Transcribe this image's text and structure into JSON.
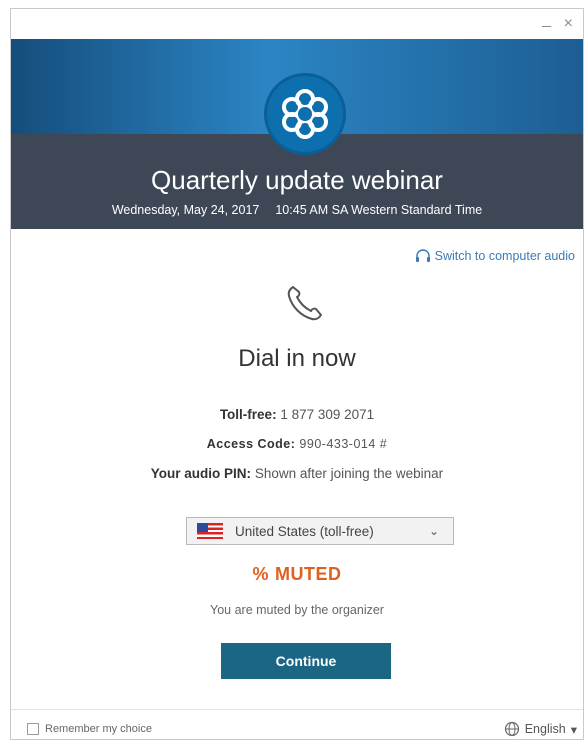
{
  "window": {
    "minimize_label": "_",
    "close_label": "×"
  },
  "banner": {
    "title": "Quarterly update webinar",
    "date": "Wednesday, May 24, 2017",
    "time": "10:45 AM SA Western Standard Time",
    "logo_icon": "flower-logo-icon"
  },
  "switch_audio": {
    "label": "Switch to computer audio",
    "icon": "headset-icon"
  },
  "dial": {
    "icon": "phone-icon",
    "title": "Dial in now",
    "toll_free_label": "Toll-free:",
    "toll_free_value": "1 877 309 2071",
    "access_code_label": "Access Code:",
    "access_code_value": "990-433-014 #",
    "audio_pin_label": "Your audio PIN:",
    "audio_pin_value": "Shown after joining the webinar"
  },
  "country_select": {
    "selected": "United States (toll-free)",
    "icon": "us-flag-icon"
  },
  "muted": {
    "label": "MUTED",
    "icon": "percent-muted-icon",
    "subtext": "You are muted by the organizer"
  },
  "continue_button": {
    "label": "Continue"
  },
  "footer": {
    "remember_label": "Remember my choice",
    "language": "English",
    "language_icon": "globe-icon"
  },
  "colors": {
    "accent": "#1b6683",
    "muted": "#e06020",
    "link": "#3b7bb8",
    "banner_dark": "#3d4756"
  }
}
